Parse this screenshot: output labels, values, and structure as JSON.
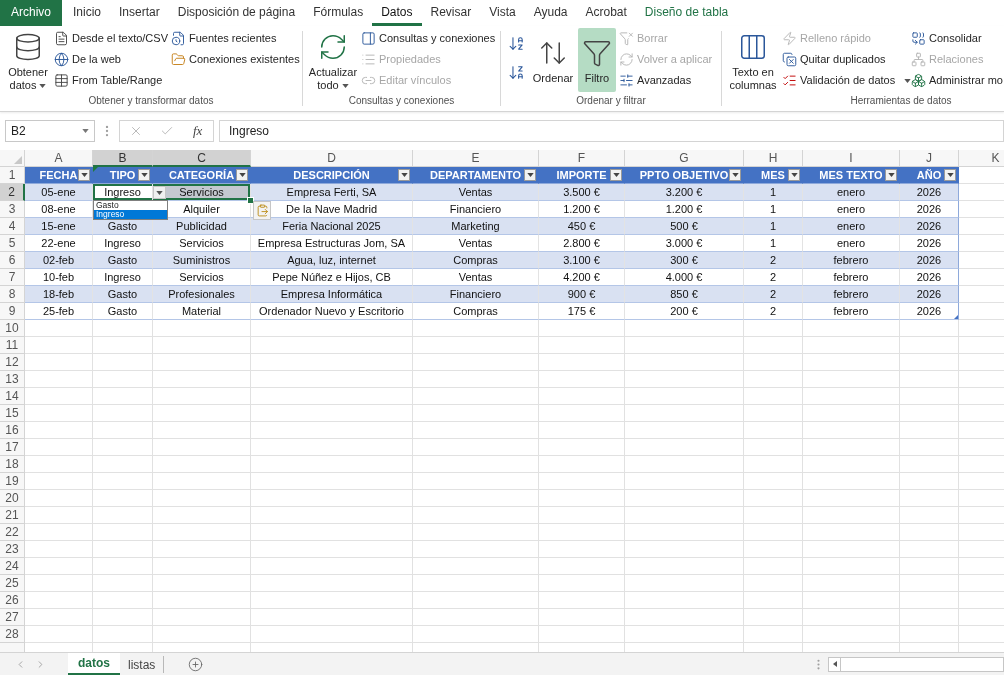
{
  "menu_tabs": [
    {
      "label": "Archivo",
      "kind": "file",
      "selected": false
    },
    {
      "label": "Inicio",
      "kind": "tab",
      "selected": false
    },
    {
      "label": "Insertar",
      "kind": "tab",
      "selected": false
    },
    {
      "label": "Disposición de página",
      "kind": "tab",
      "selected": false
    },
    {
      "label": "Fórmulas",
      "kind": "tab",
      "selected": false
    },
    {
      "label": "Datos",
      "kind": "tab",
      "selected": true
    },
    {
      "label": "Revisar",
      "kind": "tab",
      "selected": false
    },
    {
      "label": "Vista",
      "kind": "tab",
      "selected": false
    },
    {
      "label": "Ayuda",
      "kind": "tab",
      "selected": false
    },
    {
      "label": "Acrobat",
      "kind": "tab",
      "selected": false
    },
    {
      "label": "Diseño de tabla",
      "kind": "contextual",
      "selected": false
    }
  ],
  "ribbon": {
    "groups": [
      {
        "label": "Obtener y transformar datos",
        "columns": [
          [
            {
              "kind": "large",
              "label": "Obtener datos",
              "dropdown": true,
              "disabled": false,
              "on": false
            }
          ],
          [
            {
              "kind": "small",
              "label": "Desde el texto/CSV",
              "disabled": false
            },
            {
              "kind": "small",
              "label": "De la web",
              "disabled": false
            },
            {
              "kind": "small",
              "label": "From Table/Range",
              "disabled": false
            }
          ],
          [
            {
              "kind": "small",
              "label": "Fuentes recientes",
              "disabled": false
            },
            {
              "kind": "small",
              "label": "Conexiones existentes",
              "disabled": false
            }
          ]
        ]
      },
      {
        "label": "Consultas y conexiones",
        "columns": [
          [
            {
              "kind": "large",
              "label": "Actualizar todo",
              "dropdown": true,
              "disabled": false,
              "on": false
            }
          ],
          [
            {
              "kind": "small",
              "label": "Consultas y conexiones",
              "disabled": false
            },
            {
              "kind": "small",
              "label": "Propiedades",
              "disabled": true
            },
            {
              "kind": "small",
              "label": "Editar vínculos",
              "disabled": true
            }
          ]
        ]
      },
      {
        "label": "Ordenar y filtrar",
        "columns": [
          [
            {
              "kind": "icon",
              "disabled": false
            },
            {
              "kind": "icon",
              "disabled": false
            }
          ],
          [
            {
              "kind": "large",
              "label": "Ordenar",
              "disabled": false,
              "on": false
            }
          ],
          [
            {
              "kind": "large",
              "label": "Filtro",
              "disabled": false,
              "on": true
            }
          ],
          [
            {
              "kind": "small",
              "label": "Borrar",
              "disabled": true
            },
            {
              "kind": "small",
              "label": "Volver a aplicar",
              "disabled": true
            },
            {
              "kind": "small",
              "label": "Avanzadas",
              "disabled": false
            }
          ]
        ]
      },
      {
        "label": "Herramientas de datos",
        "columns": [
          [
            {
              "kind": "large",
              "label": "Texto en columnas",
              "disabled": false,
              "on": false
            }
          ],
          [
            {
              "kind": "small",
              "label": "Relleno rápido",
              "dropdown": false,
              "disabled": true
            },
            {
              "kind": "small",
              "label": "Quitar duplicados",
              "dropdown": false,
              "disabled": false
            },
            {
              "kind": "small",
              "label": "Validación de datos",
              "dropdown": true,
              "disabled": false
            }
          ],
          [
            {
              "kind": "small",
              "label": "Consolidar",
              "disabled": false
            },
            {
              "kind": "small",
              "label": "Relaciones",
              "disabled": true
            },
            {
              "kind": "small",
              "label": "Administrar mo",
              "disabled": false
            }
          ]
        ]
      }
    ]
  },
  "formula_bar": {
    "cell_ref": "B2",
    "function_label": "fx",
    "value": "Ingreso"
  },
  "sheet": {
    "column_headers": [
      {
        "label": "A",
        "selected": false
      },
      {
        "label": "B",
        "selected": true
      },
      {
        "label": "C",
        "selected": true
      },
      {
        "label": "D",
        "selected": false
      },
      {
        "label": "E",
        "selected": false
      },
      {
        "label": "F",
        "selected": false
      },
      {
        "label": "G",
        "selected": false
      },
      {
        "label": "H",
        "selected": false
      },
      {
        "label": "I",
        "selected": false
      },
      {
        "label": "J",
        "selected": false
      },
      {
        "label": "K",
        "selected": false
      }
    ],
    "row_headers": [
      {
        "label": "1",
        "selected": false
      },
      {
        "label": "2",
        "selected": true
      },
      {
        "label": "3",
        "selected": false
      },
      {
        "label": "4",
        "selected": false
      },
      {
        "label": "5",
        "selected": false
      },
      {
        "label": "6",
        "selected": false
      },
      {
        "label": "7",
        "selected": false
      },
      {
        "label": "8",
        "selected": false
      },
      {
        "label": "9",
        "selected": false
      },
      {
        "label": "10",
        "selected": false
      },
      {
        "label": "11",
        "selected": false
      },
      {
        "label": "12",
        "selected": false
      },
      {
        "label": "13",
        "selected": false
      },
      {
        "label": "14",
        "selected": false
      },
      {
        "label": "15",
        "selected": false
      },
      {
        "label": "16",
        "selected": false
      },
      {
        "label": "17",
        "selected": false
      },
      {
        "label": "18",
        "selected": false
      },
      {
        "label": "19",
        "selected": false
      },
      {
        "label": "20",
        "selected": false
      },
      {
        "label": "21",
        "selected": false
      },
      {
        "label": "22",
        "selected": false
      },
      {
        "label": "23",
        "selected": false
      },
      {
        "label": "24",
        "selected": false
      },
      {
        "label": "25",
        "selected": false
      },
      {
        "label": "26",
        "selected": false
      },
      {
        "label": "27",
        "selected": false
      },
      {
        "label": "28",
        "selected": false
      }
    ],
    "table": {
      "columns": [
        {
          "label": "FECHA",
          "flagged": false
        },
        {
          "label": "TIPO",
          "flagged": true
        },
        {
          "label": "CATEGORÍA",
          "flagged": false
        },
        {
          "label": "DESCRIPCIÓN",
          "flagged": false
        },
        {
          "label": "DEPARTAMENTO",
          "flagged": false
        },
        {
          "label": "IMPORTE",
          "flagged": false
        },
        {
          "label": "PPTO OBJETIVO",
          "flagged": false
        },
        {
          "label": "MES",
          "flagged": false
        },
        {
          "label": "MES TEXTO",
          "flagged": false
        },
        {
          "label": "AÑO",
          "flagged": false
        }
      ],
      "rows": [
        [
          "05-ene",
          "Ingreso",
          "Servicios",
          "Empresa Ferti, SA",
          "Ventas",
          "3.500 €",
          "3.200 €",
          "1",
          "enero",
          "2026"
        ],
        [
          "08-ene",
          null,
          "Alquiler",
          "De la Nave Madrid",
          "Financiero",
          "1.200 €",
          "1.200 €",
          "1",
          "enero",
          "2026"
        ],
        [
          "15-ene",
          "Gasto",
          "Publicidad",
          "Feria Nacional 2025",
          "Marketing",
          "450 €",
          "500 €",
          "1",
          "enero",
          "2026"
        ],
        [
          "22-ene",
          "Ingreso",
          "Servicios",
          "Empresa Estructuras Jom, SA",
          "Ventas",
          "2.800 €",
          "3.000 €",
          "1",
          "enero",
          "2026"
        ],
        [
          "02-feb",
          "Gasto",
          "Suministros",
          "Agua, luz, internet",
          "Compras",
          "3.100 €",
          "300 €",
          "2",
          "febrero",
          "2026"
        ],
        [
          "10-feb",
          "Ingreso",
          "Servicios",
          "Pepe Núñez e Hijos, CB",
          "Ventas",
          "4.200 €",
          "4.000 €",
          "2",
          "febrero",
          "2026"
        ],
        [
          "18-feb",
          "Gasto",
          "Profesionales",
          "Empresa Informática",
          "Financiero",
          "900 €",
          "850 €",
          "2",
          "febrero",
          "2026"
        ],
        [
          "25-feb",
          "Gasto",
          "Material",
          "Ordenador Nuevo y Escritorio",
          "Compras",
          "175 €",
          "200 €",
          "2",
          "febrero",
          "2026"
        ]
      ]
    },
    "validation_list": {
      "options": [
        {
          "label": "Gasto",
          "selected": false
        },
        {
          "label": "Ingreso",
          "selected": true
        }
      ]
    }
  },
  "sheet_tabs": [
    {
      "label": "datos",
      "selected": true
    },
    {
      "label": "listas",
      "selected": false
    }
  ]
}
